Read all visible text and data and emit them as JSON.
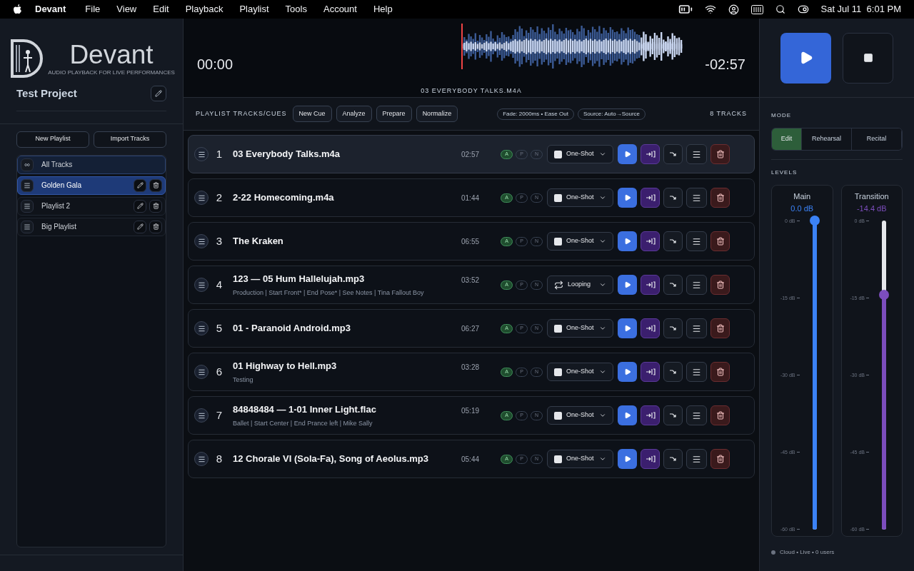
{
  "menubar": {
    "app": "Devant",
    "menus": [
      "File",
      "View",
      "Edit",
      "Playback",
      "Playlist",
      "Tools",
      "Account",
      "Help"
    ],
    "clock": "Sat Jul 11  6:01 PM"
  },
  "sidebar": {
    "logo_text": "Devant",
    "logo_tagline": "AUDIO PLAYBACK FOR LIVE PERFORMANCES",
    "project": "Test Project",
    "buttons": [
      "New Playlist",
      "Import Tracks"
    ],
    "playlists": [
      {
        "label": "All Tracks",
        "kind": "all",
        "selected": false
      },
      {
        "label": "Golden Gala",
        "kind": "playlist",
        "selected": true
      },
      {
        "label": "Playlist 2",
        "kind": "playlist",
        "selected": false
      },
      {
        "label": "Big Playlist",
        "kind": "playlist",
        "selected": false
      }
    ]
  },
  "player": {
    "elapsed": "00:00",
    "remaining": "-02:57",
    "track": "03 EVERYBODY TALKS.M4A"
  },
  "toolbar": {
    "title": "PLAYLIST TRACKS/CUES",
    "buttons": [
      "New Cue",
      "Analyze",
      "Prepare",
      "Normalize"
    ],
    "chips": [
      "Fade: 2000ms • Ease Out",
      "Source: Auto→Source"
    ],
    "count": "8 TRACKS"
  },
  "tracks": [
    {
      "number": "1",
      "title": "03 Everybody Talks.m4a",
      "duration": "02:57",
      "selected": true,
      "mode": {
        "kind": "one-shot",
        "label": "One-Shot"
      },
      "flags": [
        {
          "label": "A",
          "selected": true
        },
        {
          "label": "P",
          "selected": false
        },
        {
          "label": "N",
          "selected": false
        }
      ]
    },
    {
      "number": "2",
      "title": "2-22 Homecoming.m4a",
      "duration": "01:44",
      "selected": false,
      "mode": {
        "kind": "one-shot",
        "label": "One-Shot"
      },
      "flags": [
        {
          "label": "A",
          "selected": true
        },
        {
          "label": "P",
          "selected": false
        },
        {
          "label": "N",
          "selected": false
        }
      ]
    },
    {
      "number": "3",
      "title": "The Kraken",
      "duration": "06:55",
      "selected": false,
      "mode": {
        "kind": "one-shot",
        "label": "One-Shot"
      },
      "flags": [
        {
          "label": "A",
          "selected": true
        },
        {
          "label": "P",
          "selected": false
        },
        {
          "label": "N",
          "selected": false
        }
      ]
    },
    {
      "number": "4",
      "title": "123 — 05 Hum Hallelujah.mp3",
      "subtitle": "Production | Start Front* | End Pose* | See Notes | Tina Fallout Boy",
      "duration": "03:52",
      "selected": false,
      "mode": {
        "kind": "looping",
        "label": "Looping"
      },
      "flags": [
        {
          "label": "A",
          "selected": true
        },
        {
          "label": "P",
          "selected": false
        },
        {
          "label": "N",
          "selected": false
        }
      ]
    },
    {
      "number": "5",
      "title": "01 - Paranoid Android.mp3",
      "duration": "06:27",
      "selected": false,
      "mode": {
        "kind": "one-shot",
        "label": "One-Shot"
      },
      "flags": [
        {
          "label": "A",
          "selected": true
        },
        {
          "label": "P",
          "selected": false
        },
        {
          "label": "N",
          "selected": false
        }
      ]
    },
    {
      "number": "6",
      "title": "01 Highway to Hell.mp3",
      "subtitle": "Testing",
      "duration": "03:28",
      "selected": false,
      "mode": {
        "kind": "one-shot",
        "label": "One-Shot"
      },
      "flags": [
        {
          "label": "A",
          "selected": true
        },
        {
          "label": "P",
          "selected": false
        },
        {
          "label": "N",
          "selected": false
        }
      ]
    },
    {
      "number": "7",
      "title": "84848484 — 1-01 Inner Light.flac",
      "subtitle": "Ballet | Start Center | End Prance left | Mike Sally",
      "duration": "05:19",
      "selected": false,
      "mode": {
        "kind": "one-shot",
        "label": "One-Shot"
      },
      "flags": [
        {
          "label": "A",
          "selected": true
        },
        {
          "label": "P",
          "selected": false
        },
        {
          "label": "N",
          "selected": false
        }
      ]
    },
    {
      "number": "8",
      "title": "12 Chorale VI (Sola-Fa), Song of Aeolus.mp3",
      "duration": "05:44",
      "selected": false,
      "mode": {
        "kind": "one-shot",
        "label": "One-Shot"
      },
      "flags": [
        {
          "label": "A",
          "selected": true
        },
        {
          "label": "P",
          "selected": false
        },
        {
          "label": "N",
          "selected": false
        }
      ]
    }
  ],
  "right": {
    "mode_heading": "MODE",
    "modes": [
      {
        "label": "Edit",
        "selected": true
      },
      {
        "label": "Rehearsal",
        "selected": false
      },
      {
        "label": "Recital",
        "selected": false
      }
    ],
    "levels_heading": "LEVELS",
    "faders": [
      {
        "name": "Main",
        "reading": "0.0 dB",
        "level": 1.0,
        "color": "#3b82f6",
        "ticks": [
          "0 dB",
          "-15 dB",
          "-30 dB",
          "-45 dB",
          "-60 dB"
        ]
      },
      {
        "name": "Transition",
        "reading": "-14.4 dB",
        "level": 0.76,
        "color": "#7c4dbd",
        "ticks": [
          "0 dB",
          "-15 dB",
          "-30 dB",
          "-45 dB",
          "-60 dB"
        ]
      }
    ],
    "status": {
      "text": "Cloud • Live • 0 users",
      "color": "#6b7280"
    }
  }
}
